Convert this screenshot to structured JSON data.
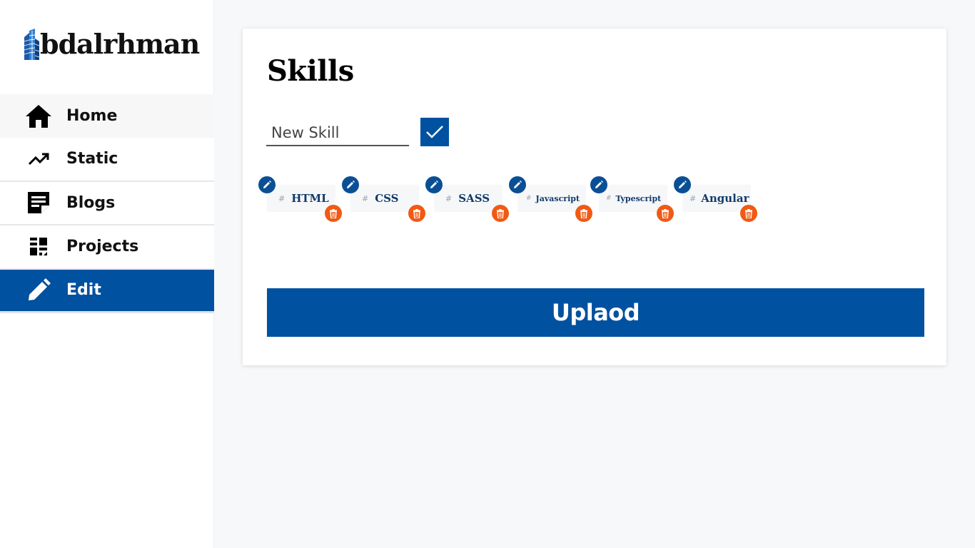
{
  "brand": {
    "logo_text": "bdalrhman"
  },
  "sidebar": {
    "items": [
      {
        "label": "Home",
        "icon": "home-icon"
      },
      {
        "label": "Static",
        "icon": "trending-up-icon"
      },
      {
        "label": "Blogs",
        "icon": "sticky-note-icon"
      },
      {
        "label": "Projects",
        "icon": "dashboard-icon"
      },
      {
        "label": "Edit",
        "icon": "pencil-icon",
        "active": true
      }
    ]
  },
  "card": {
    "title": "Skills",
    "input_placeholder": "New Skill",
    "skills": [
      {
        "hash": "#",
        "label": "HTML"
      },
      {
        "hash": "#",
        "label": "CSS"
      },
      {
        "hash": "#",
        "label": "SASS"
      },
      {
        "hash": "#",
        "label": "Javascript"
      },
      {
        "hash": "#",
        "label": "Typescript"
      },
      {
        "hash": "#",
        "label": "Angular"
      }
    ],
    "upload_label": "Uplaod"
  },
  "colors": {
    "primary": "#0051a0",
    "delete": "#f05a14",
    "chip_text": "#123a6a",
    "page_bg": "#f7f8fa"
  }
}
